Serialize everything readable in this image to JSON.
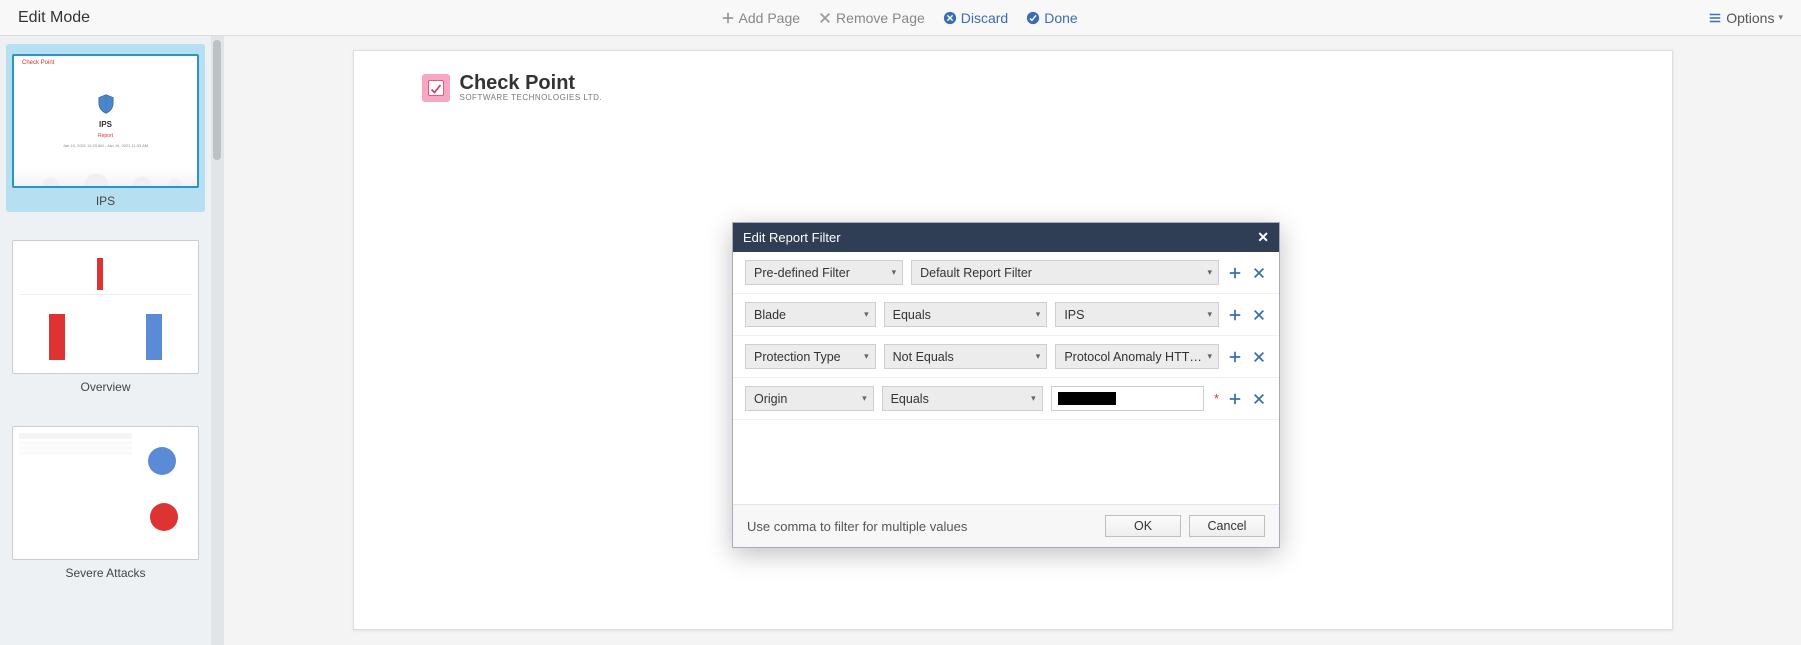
{
  "topbar": {
    "title": "Edit Mode",
    "add_page": "Add Page",
    "remove_page": "Remove Page",
    "discard": "Discard",
    "done": "Done",
    "options": "Options"
  },
  "sidebar": {
    "thumbs": [
      {
        "label": "IPS",
        "title": "IPS",
        "subtitle": "Report",
        "timeframe": "Jan 19, 2021 11:33 AM - Jan 19, 2021 11:33 AM",
        "brand": "Check Point"
      },
      {
        "label": "Overview"
      },
      {
        "label": "Severe Attacks"
      }
    ]
  },
  "page": {
    "brand_name": "Check Point",
    "brand_sub": "SOFTWARE TECHNOLOGIES LTD."
  },
  "modal": {
    "title": "Edit Report Filter",
    "rows": [
      {
        "field": "Pre-defined Filter",
        "op": "",
        "value": "Default Report Filter"
      },
      {
        "field": "Blade",
        "op": "Equals",
        "value": "IPS"
      },
      {
        "field": "Protection Type",
        "op": "Not Equals",
        "value": "Protocol Anomaly HTTP,Proto..."
      },
      {
        "field": "Origin",
        "op": "Equals",
        "value": ""
      }
    ],
    "hint": "Use comma to filter for multiple values",
    "ok": "OK",
    "cancel": "Cancel"
  }
}
